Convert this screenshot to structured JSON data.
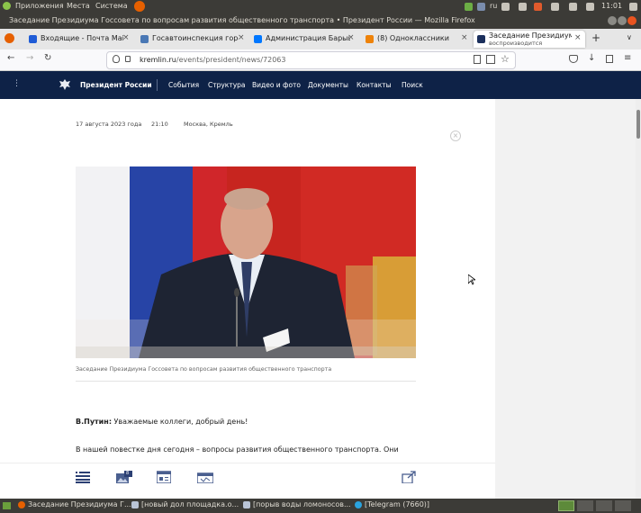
{
  "os_panel": {
    "menus": [
      "Приложения",
      "Места",
      "Система"
    ],
    "lang": "ru",
    "clock": "11:01"
  },
  "window": {
    "title": "Заседание Президиума Госсовета по вопросам развития общественного транспорта • Президент России — Mozilla Firefox"
  },
  "tabs": [
    {
      "label": "Входящие - Почта Mail.ru",
      "icon": "mail-icon"
    },
    {
      "label": "Госавтоинспекция города",
      "icon": "gibdd-icon"
    },
    {
      "label": "Администрация Барыша",
      "icon": "vk-icon"
    },
    {
      "label": "(8) Одноклассники",
      "icon": "ok-icon"
    },
    {
      "label": "Заседание Президиума",
      "sublabel": "воспроизводится",
      "icon": "kremlin-icon",
      "active": true
    }
  ],
  "navbar": {
    "url_host": "kremlin.ru",
    "url_path": "/events/president/news/72063"
  },
  "site": {
    "brand": "Президент России",
    "nav": [
      "События",
      "Структура",
      "Видео и фото",
      "Документы",
      "Контакты",
      "Поиск"
    ]
  },
  "article": {
    "date": "17 августа 2023 года",
    "time": "21:10",
    "place": "Москва, Кремль",
    "caption": "Заседание Президиума Госсовета по вопросам развития общественного транспорта",
    "speaker": "В.Путин:",
    "speech": " Уважаемые коллеги, добрый день!",
    "para2": "В нашей повестке дня сегодня – вопросы развития общественного транспорта. Они",
    "photo_count": "8"
  },
  "taskbar": [
    {
      "label": "Заседание Президиума Г...",
      "icon": "firefox-icon"
    },
    {
      "label": "[новый дол площадка.о...",
      "icon": "document-icon"
    },
    {
      "label": "[порыв воды ломоносов...",
      "icon": "document-icon"
    },
    {
      "label": "[Telegram (7660)]",
      "icon": "telegram-icon"
    }
  ],
  "colors": {
    "site_header": "#0e2247",
    "os_panel": "#3c3b37"
  }
}
